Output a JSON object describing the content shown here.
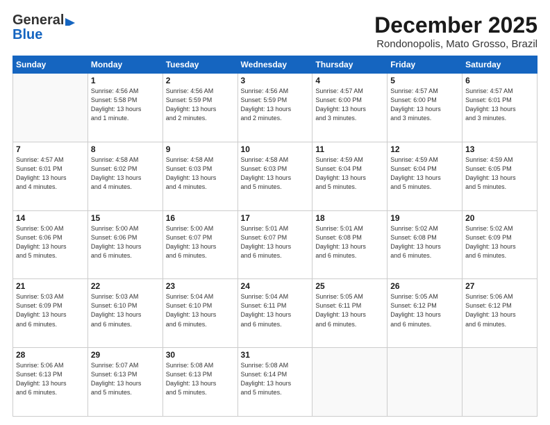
{
  "header": {
    "logo_line1": "General",
    "logo_line2": "Blue",
    "month": "December 2025",
    "location": "Rondonopolis, Mato Grosso, Brazil"
  },
  "weekdays": [
    "Sunday",
    "Monday",
    "Tuesday",
    "Wednesday",
    "Thursday",
    "Friday",
    "Saturday"
  ],
  "weeks": [
    [
      {
        "day": "",
        "info": ""
      },
      {
        "day": "1",
        "info": "Sunrise: 4:56 AM\nSunset: 5:58 PM\nDaylight: 13 hours\nand 1 minute."
      },
      {
        "day": "2",
        "info": "Sunrise: 4:56 AM\nSunset: 5:59 PM\nDaylight: 13 hours\nand 2 minutes."
      },
      {
        "day": "3",
        "info": "Sunrise: 4:56 AM\nSunset: 5:59 PM\nDaylight: 13 hours\nand 2 minutes."
      },
      {
        "day": "4",
        "info": "Sunrise: 4:57 AM\nSunset: 6:00 PM\nDaylight: 13 hours\nand 3 minutes."
      },
      {
        "day": "5",
        "info": "Sunrise: 4:57 AM\nSunset: 6:00 PM\nDaylight: 13 hours\nand 3 minutes."
      },
      {
        "day": "6",
        "info": "Sunrise: 4:57 AM\nSunset: 6:01 PM\nDaylight: 13 hours\nand 3 minutes."
      }
    ],
    [
      {
        "day": "7",
        "info": "Sunrise: 4:57 AM\nSunset: 6:01 PM\nDaylight: 13 hours\nand 4 minutes."
      },
      {
        "day": "8",
        "info": "Sunrise: 4:58 AM\nSunset: 6:02 PM\nDaylight: 13 hours\nand 4 minutes."
      },
      {
        "day": "9",
        "info": "Sunrise: 4:58 AM\nSunset: 6:03 PM\nDaylight: 13 hours\nand 4 minutes."
      },
      {
        "day": "10",
        "info": "Sunrise: 4:58 AM\nSunset: 6:03 PM\nDaylight: 13 hours\nand 5 minutes."
      },
      {
        "day": "11",
        "info": "Sunrise: 4:59 AM\nSunset: 6:04 PM\nDaylight: 13 hours\nand 5 minutes."
      },
      {
        "day": "12",
        "info": "Sunrise: 4:59 AM\nSunset: 6:04 PM\nDaylight: 13 hours\nand 5 minutes."
      },
      {
        "day": "13",
        "info": "Sunrise: 4:59 AM\nSunset: 6:05 PM\nDaylight: 13 hours\nand 5 minutes."
      }
    ],
    [
      {
        "day": "14",
        "info": "Sunrise: 5:00 AM\nSunset: 6:06 PM\nDaylight: 13 hours\nand 5 minutes."
      },
      {
        "day": "15",
        "info": "Sunrise: 5:00 AM\nSunset: 6:06 PM\nDaylight: 13 hours\nand 6 minutes."
      },
      {
        "day": "16",
        "info": "Sunrise: 5:00 AM\nSunset: 6:07 PM\nDaylight: 13 hours\nand 6 minutes."
      },
      {
        "day": "17",
        "info": "Sunrise: 5:01 AM\nSunset: 6:07 PM\nDaylight: 13 hours\nand 6 minutes."
      },
      {
        "day": "18",
        "info": "Sunrise: 5:01 AM\nSunset: 6:08 PM\nDaylight: 13 hours\nand 6 minutes."
      },
      {
        "day": "19",
        "info": "Sunrise: 5:02 AM\nSunset: 6:08 PM\nDaylight: 13 hours\nand 6 minutes."
      },
      {
        "day": "20",
        "info": "Sunrise: 5:02 AM\nSunset: 6:09 PM\nDaylight: 13 hours\nand 6 minutes."
      }
    ],
    [
      {
        "day": "21",
        "info": "Sunrise: 5:03 AM\nSunset: 6:09 PM\nDaylight: 13 hours\nand 6 minutes."
      },
      {
        "day": "22",
        "info": "Sunrise: 5:03 AM\nSunset: 6:10 PM\nDaylight: 13 hours\nand 6 minutes."
      },
      {
        "day": "23",
        "info": "Sunrise: 5:04 AM\nSunset: 6:10 PM\nDaylight: 13 hours\nand 6 minutes."
      },
      {
        "day": "24",
        "info": "Sunrise: 5:04 AM\nSunset: 6:11 PM\nDaylight: 13 hours\nand 6 minutes."
      },
      {
        "day": "25",
        "info": "Sunrise: 5:05 AM\nSunset: 6:11 PM\nDaylight: 13 hours\nand 6 minutes."
      },
      {
        "day": "26",
        "info": "Sunrise: 5:05 AM\nSunset: 6:12 PM\nDaylight: 13 hours\nand 6 minutes."
      },
      {
        "day": "27",
        "info": "Sunrise: 5:06 AM\nSunset: 6:12 PM\nDaylight: 13 hours\nand 6 minutes."
      }
    ],
    [
      {
        "day": "28",
        "info": "Sunrise: 5:06 AM\nSunset: 6:13 PM\nDaylight: 13 hours\nand 6 minutes."
      },
      {
        "day": "29",
        "info": "Sunrise: 5:07 AM\nSunset: 6:13 PM\nDaylight: 13 hours\nand 5 minutes."
      },
      {
        "day": "30",
        "info": "Sunrise: 5:08 AM\nSunset: 6:13 PM\nDaylight: 13 hours\nand 5 minutes."
      },
      {
        "day": "31",
        "info": "Sunrise: 5:08 AM\nSunset: 6:14 PM\nDaylight: 13 hours\nand 5 minutes."
      },
      {
        "day": "",
        "info": ""
      },
      {
        "day": "",
        "info": ""
      },
      {
        "day": "",
        "info": ""
      }
    ]
  ]
}
